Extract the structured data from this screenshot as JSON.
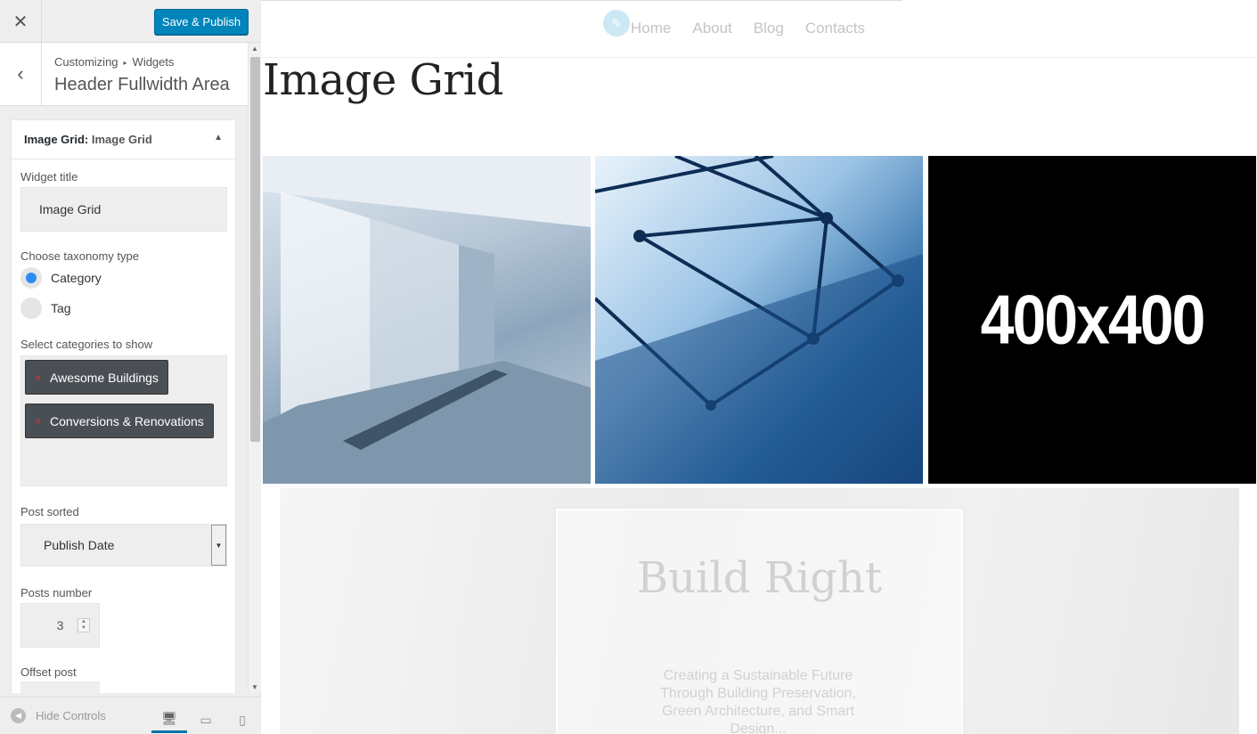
{
  "toolbar": {
    "close_icon": "close-icon",
    "save_label": "Save & Publish"
  },
  "section": {
    "breadcrumb_parent": "Customizing",
    "breadcrumb_separator": "▸",
    "breadcrumb_current": "Widgets",
    "title": "Header Fullwidth Area"
  },
  "widget": {
    "type_label": "Image Grid:",
    "name": "Image Grid",
    "fields": {
      "title_label": "Widget title",
      "title_value": "Image Grid",
      "taxonomy_label": "Choose taxonomy type",
      "taxonomy_options": [
        {
          "label": "Category",
          "selected": true
        },
        {
          "label": "Tag",
          "selected": false
        }
      ],
      "categories_label": "Select categories to show",
      "categories": [
        "Awesome Buildings",
        "Conversions & Renovations"
      ],
      "remove_glyph": "×",
      "sort_label": "Post sorted",
      "sort_value": "Publish Date",
      "posts_number_label": "Posts number",
      "posts_number_value": "3",
      "offset_label": "Offset post"
    }
  },
  "footer": {
    "hide_controls": "Hide Controls",
    "devices": [
      "desktop-icon",
      "tablet-icon",
      "mobile-icon"
    ],
    "active_device": "desktop"
  },
  "preview": {
    "nav": [
      "Home",
      "About",
      "Blog",
      "Contacts"
    ],
    "page_title": "Image Grid",
    "grid": [
      {
        "kind": "photo",
        "alt": "interior-office-photo"
      },
      {
        "kind": "photo",
        "alt": "glass-steel-roof-photo"
      },
      {
        "kind": "placeholder",
        "text": "400x400"
      }
    ],
    "hero_title": "Build Right",
    "hero_text": "Creating a Sustainable Future Through Building Preservation, Green Architecture, and Smart Design..."
  },
  "colors": {
    "accent": "#0085ba",
    "radio_selected": "#2f8cf4",
    "remove_x": "#dc3232"
  }
}
